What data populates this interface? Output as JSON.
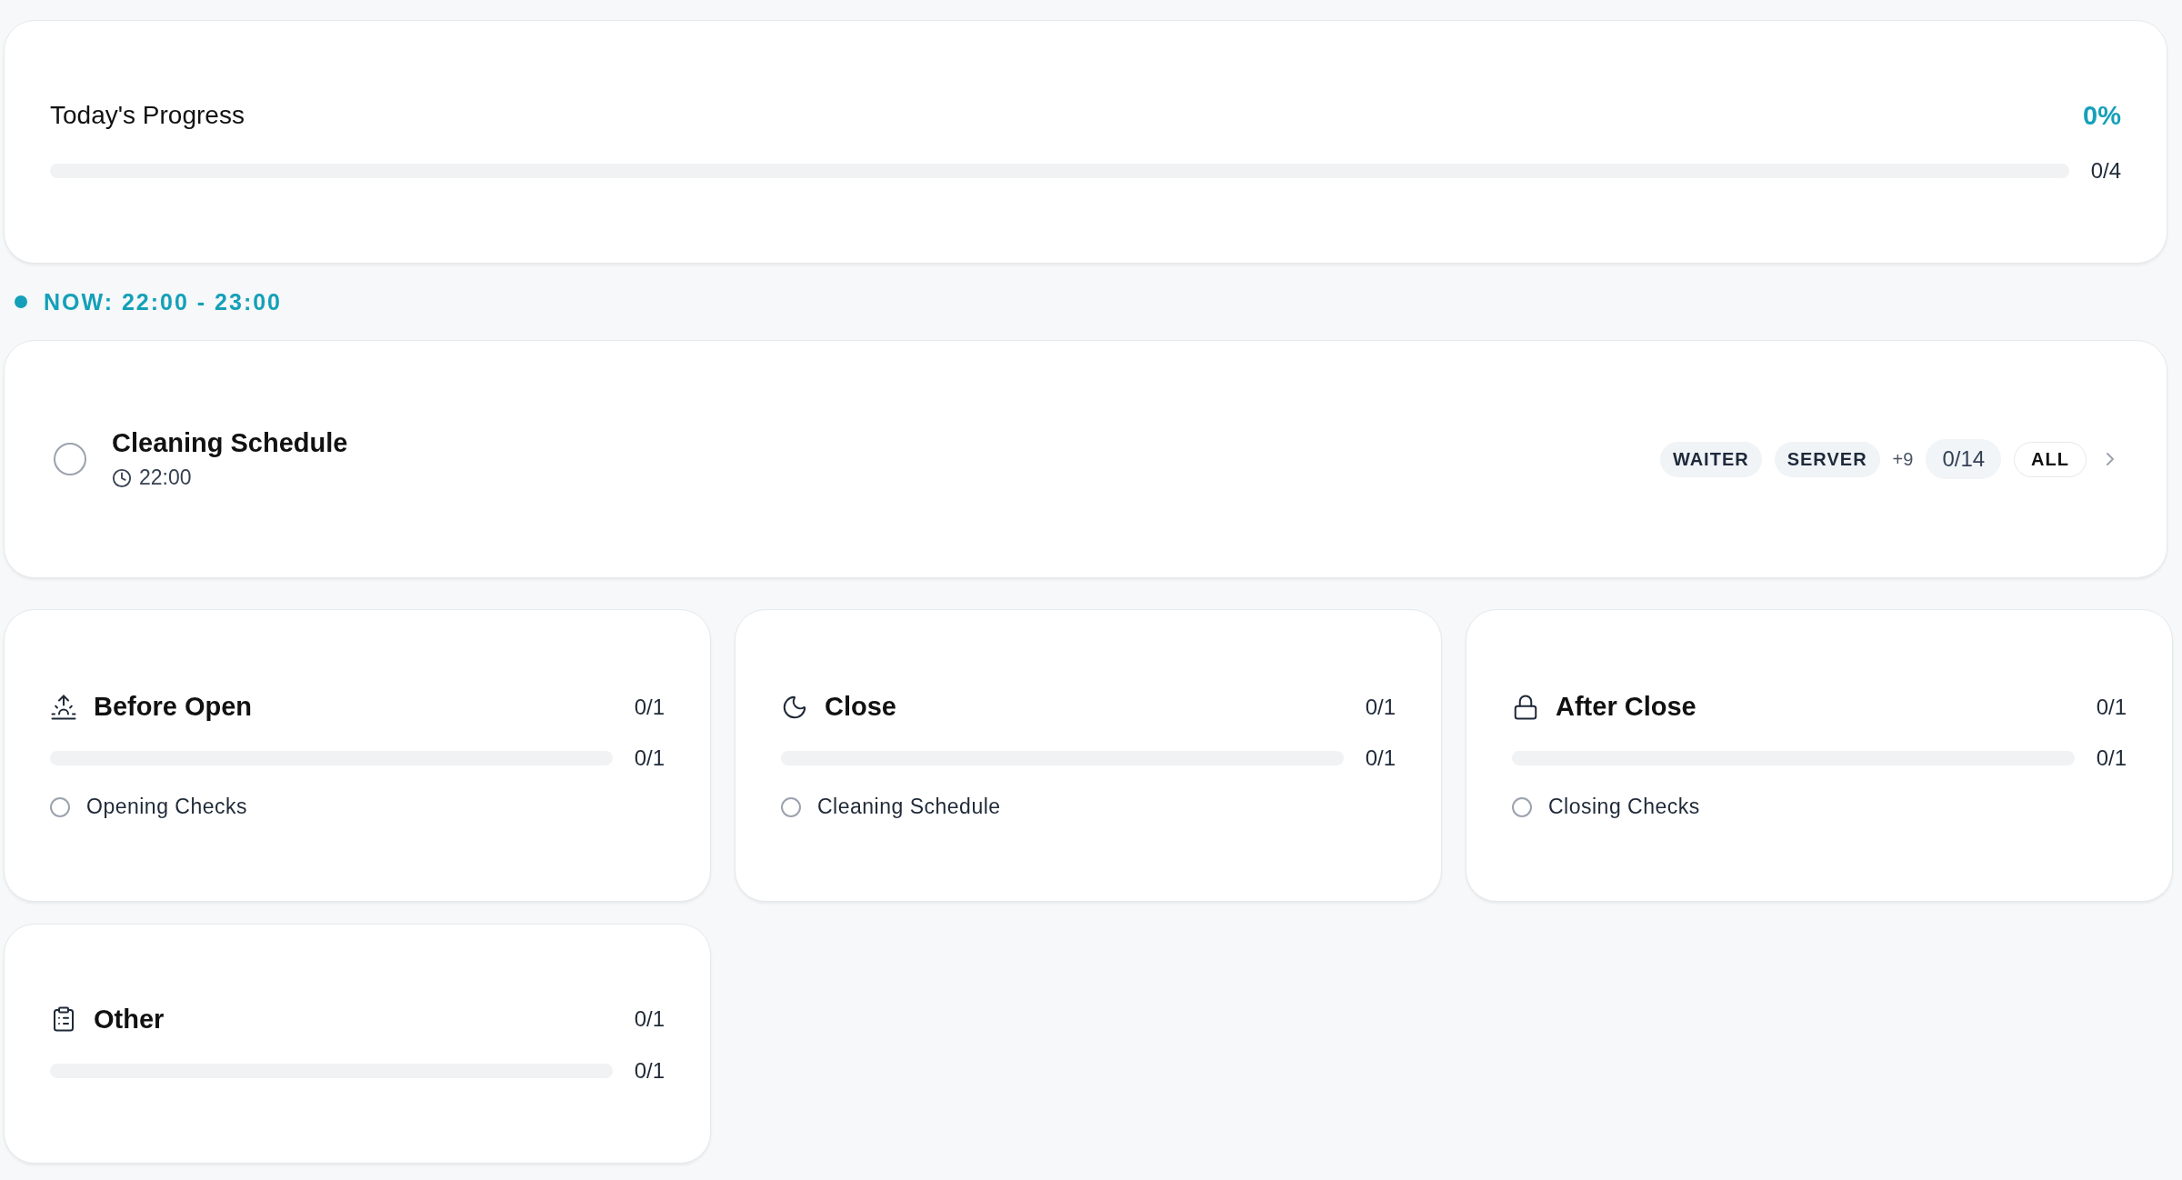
{
  "progress": {
    "title": "Today's Progress",
    "percent": "0%",
    "count": "0/4",
    "level": 0
  },
  "now": {
    "label": "NOW: 22:00 - 23:00"
  },
  "current_task": {
    "title": "Cleaning Schedule",
    "time": "22:00",
    "checked": false,
    "roles": [
      "WAITER",
      "SERVER"
    ],
    "more_roles": "+9",
    "count": "0/14",
    "scope": "ALL"
  },
  "categories": [
    {
      "kind": "sunrise",
      "title": "Before Open",
      "count": "0/1",
      "bar_count": "0/1",
      "level": 0,
      "tasks": [
        {
          "label": "Opening Checks",
          "checked": false
        }
      ]
    },
    {
      "kind": "moon",
      "title": "Close",
      "count": "0/1",
      "bar_count": "0/1",
      "level": 0,
      "tasks": [
        {
          "label": "Cleaning Schedule",
          "checked": false
        }
      ]
    },
    {
      "kind": "lock",
      "title": "After Close",
      "count": "0/1",
      "bar_count": "0/1",
      "level": 0,
      "tasks": [
        {
          "label": "Closing Checks",
          "checked": false
        }
      ]
    },
    {
      "kind": "clipboard",
      "title": "Other",
      "count": "0/1",
      "bar_count": "0/1",
      "level": 0
    }
  ]
}
